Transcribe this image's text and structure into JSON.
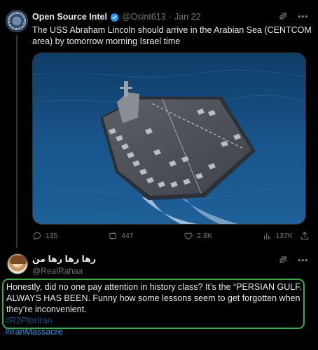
{
  "tweet1": {
    "display_name": "Open Source Intel",
    "handle": "@Osint613",
    "separator": "·",
    "date": "Jan 22",
    "text": "The USS Abraham Lincoln should arrive in the Arabian Sea (CENTCOM area) by tomorrow morning Israel time",
    "image_subject": "aircraft carrier at sea",
    "stats": {
      "replies": "135",
      "reposts": "447",
      "likes": "2.8K",
      "views": "137K"
    }
  },
  "tweet2": {
    "display_name": "رها رها رها من",
    "handle": "@RealRahaa",
    "text": "Honestly, did no one pay attention in history class? It’s the “PERSIAN GULF. ALWAYS HAS BEEN. Funny how some lessons seem to get forgotten when they’re inconvenient.",
    "hashtags": [
      "#R2PforIran",
      "#IranMassacre"
    ],
    "highlight_color": "#2fb341"
  },
  "colors": {
    "background": "#000000",
    "text": "#e7e9ea",
    "muted": "#71767b",
    "link": "#1d9bf0",
    "verified": "#1d9bf0"
  },
  "icons": [
    "verified-badge-icon",
    "grok-icon",
    "more-icon",
    "reply-icon",
    "repost-icon",
    "like-icon",
    "views-icon",
    "share-icon"
  ]
}
